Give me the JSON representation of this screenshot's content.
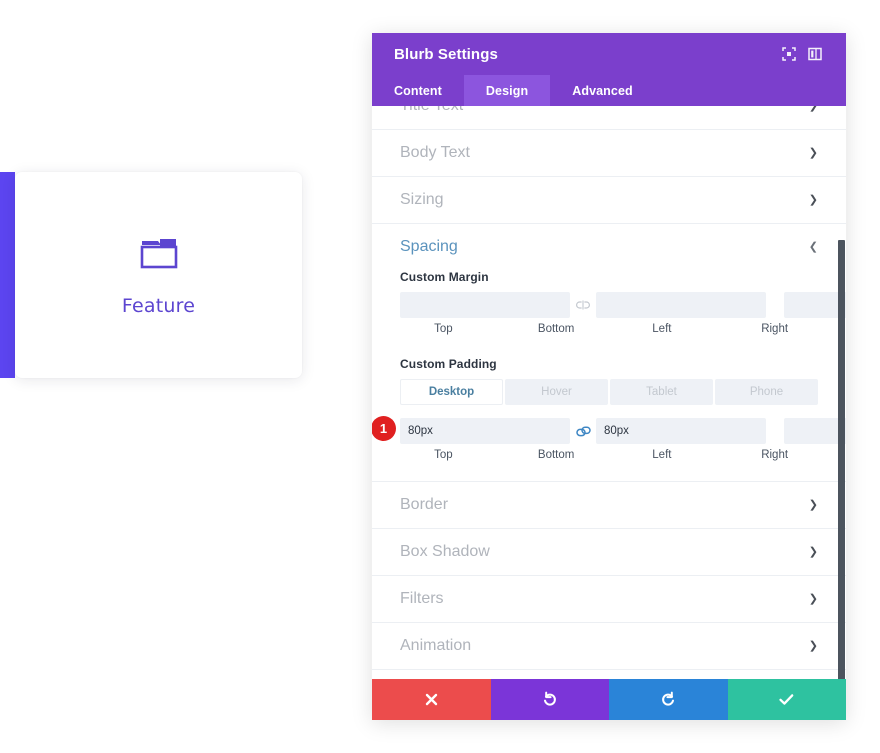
{
  "preview": {
    "icon_name": "folder-icon",
    "title": "Feature",
    "accent_bar_color": "#5c45f0",
    "icon_color": "#5c45d0"
  },
  "modal": {
    "title": "Blurb Settings",
    "header_color": "#7b3fcc",
    "header_icons": [
      {
        "name": "expand-fullscreen-icon"
      },
      {
        "name": "panel-layout-icon"
      }
    ],
    "tabs": [
      {
        "label": "Content",
        "active": false
      },
      {
        "label": "Design",
        "active": true
      },
      {
        "label": "Advanced",
        "active": false
      }
    ]
  },
  "sections": [
    {
      "name": "Title Text",
      "open": false
    },
    {
      "name": "Body Text",
      "open": false
    },
    {
      "name": "Sizing",
      "open": false
    },
    {
      "name": "Spacing",
      "open": true
    },
    {
      "name": "Border",
      "open": false
    },
    {
      "name": "Box Shadow",
      "open": false
    },
    {
      "name": "Filters",
      "open": false
    },
    {
      "name": "Animation",
      "open": false
    }
  ],
  "spacing": {
    "title": "Spacing",
    "custom_margin": {
      "label": "Custom Margin",
      "top": {
        "value": "",
        "placeholder": "",
        "caption": "Top"
      },
      "bottom": {
        "value": "",
        "placeholder": "",
        "caption": "Bottom"
      },
      "left": {
        "value": "",
        "placeholder": "",
        "caption": "Left"
      },
      "right": {
        "value": "",
        "placeholder": "",
        "caption": "Right"
      },
      "link_tb": {
        "name": "unlink-icon",
        "linked": false
      },
      "link_lr": {
        "name": "unlink-icon",
        "linked": false
      }
    },
    "custom_padding": {
      "label": "Custom Padding",
      "responsive_tabs": [
        {
          "label": "Desktop",
          "active": true
        },
        {
          "label": "Hover",
          "active": false
        },
        {
          "label": "Tablet",
          "active": false
        },
        {
          "label": "Phone",
          "active": false
        }
      ],
      "badge": "1",
      "top": {
        "value": "80px",
        "placeholder": "",
        "caption": "Top"
      },
      "bottom": {
        "value": "80px",
        "placeholder": "",
        "caption": "Bottom"
      },
      "left": {
        "value": "",
        "placeholder": "",
        "caption": "Left"
      },
      "right": {
        "value": "",
        "placeholder": "",
        "caption": "Right"
      },
      "link_tb": {
        "name": "link-icon",
        "linked": true
      },
      "link_lr": {
        "name": "unlink-icon",
        "linked": false
      }
    }
  },
  "actions": [
    {
      "name": "cancel-button",
      "icon": "close-icon",
      "color": "#ec4c4c"
    },
    {
      "name": "undo-button",
      "icon": "undo-icon",
      "color": "#7b35d8"
    },
    {
      "name": "redo-button",
      "icon": "redo-icon",
      "color": "#2a84d8"
    },
    {
      "name": "save-button",
      "icon": "checkmark-icon",
      "color": "#2ec2a0"
    }
  ]
}
